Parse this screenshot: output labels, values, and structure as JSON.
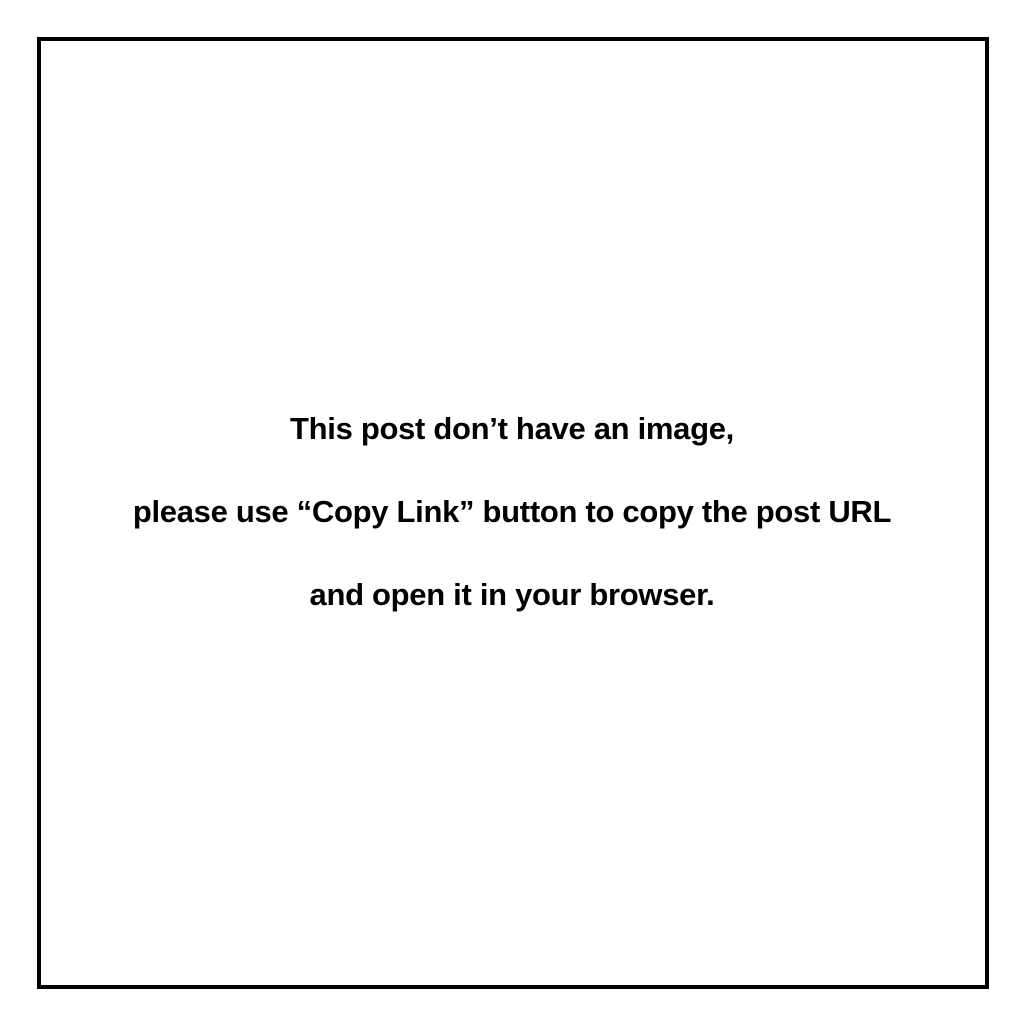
{
  "placeholder": {
    "line_1": "This post don’t have an image,",
    "line_2": "please use “Copy Link” button to copy the post URL",
    "line_3": "and open it in your browser."
  },
  "colors": {
    "background": "#ffffff",
    "border": "#000000",
    "text": "#000000"
  }
}
